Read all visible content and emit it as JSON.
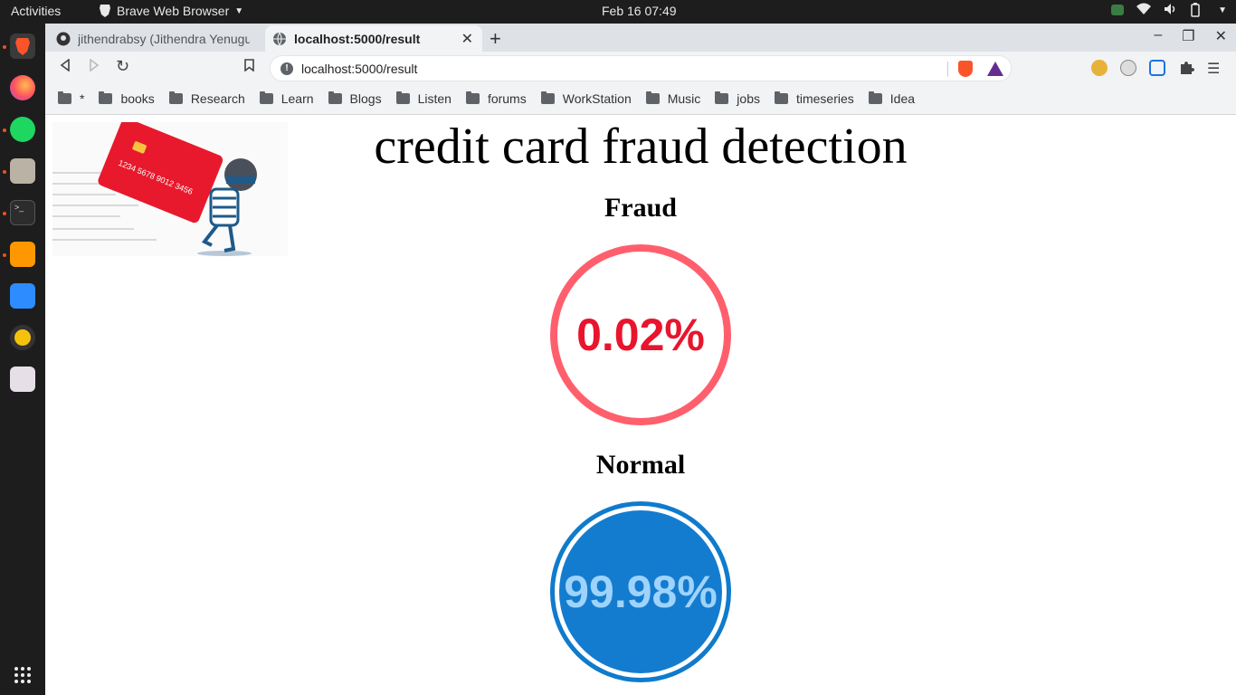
{
  "system": {
    "activities": "Activities",
    "app_name": "Brave Web Browser",
    "clock": "Feb 16  07:49"
  },
  "browser": {
    "tabs": [
      {
        "title": "jithendrabsy (Jithendra Yenugu",
        "icon": "github-icon"
      },
      {
        "title": "localhost:5000/result",
        "icon": "globe-icon"
      }
    ],
    "url": "localhost:5000/result",
    "bookmarks": [
      "*",
      "books",
      "Research",
      "Learn",
      "Blogs",
      "Listen",
      "forums",
      "WorkStation",
      "Music",
      "jobs",
      "timeseries",
      "Idea"
    ]
  },
  "page": {
    "title": "credit card fraud detection",
    "fraud": {
      "label": "Fraud",
      "value": "0.02%"
    },
    "normal": {
      "label": "Normal",
      "value": "99.98%"
    }
  },
  "colors": {
    "fraud_ring": "#ff5f6d",
    "fraud_text": "#e8152d",
    "normal_fill": "#147ccf",
    "normal_text": "#9ed3fb"
  }
}
